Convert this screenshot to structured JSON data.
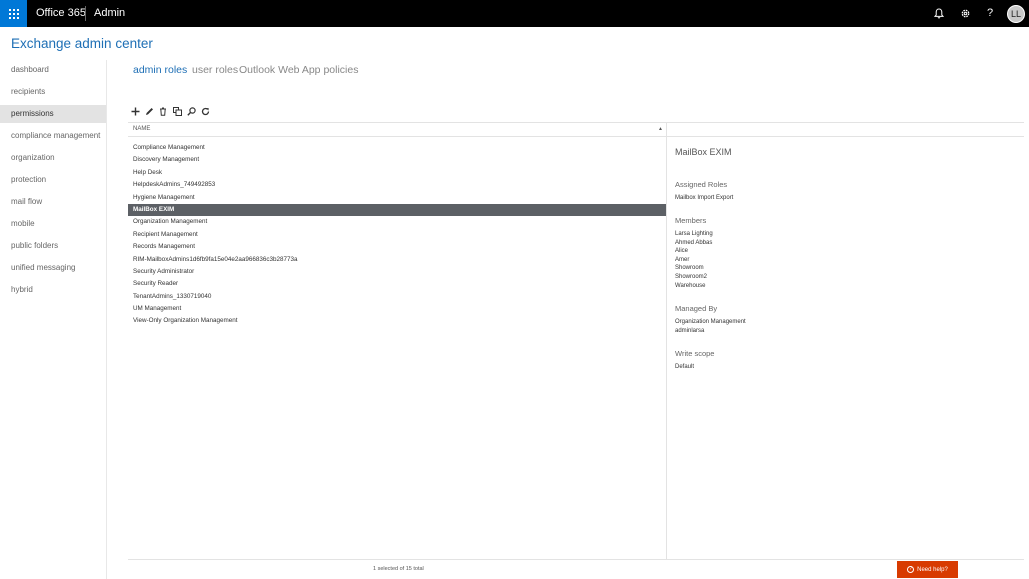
{
  "topbar": {
    "brand": "Office 365",
    "section": "Admin",
    "avatar_initials": "LL",
    "icons": [
      "app-launcher-icon",
      "bell-icon",
      "gear-icon",
      "help-icon"
    ]
  },
  "header": {
    "title": "Exchange admin center"
  },
  "nav": {
    "items": [
      {
        "label": "dashboard"
      },
      {
        "label": "recipients"
      },
      {
        "label": "permissions"
      },
      {
        "label": "compliance management"
      },
      {
        "label": "organization"
      },
      {
        "label": "protection"
      },
      {
        "label": "mail flow"
      },
      {
        "label": "mobile"
      },
      {
        "label": "public folders"
      },
      {
        "label": "unified messaging"
      },
      {
        "label": "hybrid"
      }
    ],
    "active": "permissions"
  },
  "tabs": [
    {
      "label": "admin roles"
    },
    {
      "label": "user roles"
    },
    {
      "label": "Outlook Web App policies"
    }
  ],
  "toolbar": {
    "icons": [
      "add-icon",
      "edit-icon",
      "delete-icon",
      "copy-icon",
      "search-icon",
      "refresh-icon"
    ]
  },
  "list": {
    "column_header": "NAME",
    "rows": [
      "Compliance Management",
      "Discovery Management",
      "Help Desk",
      "HelpdeskAdmins_749492853",
      "Hygiene Management",
      "MailBox EXIM",
      "Organization Management",
      "Recipient Management",
      "Records Management",
      "RIM-MailboxAdmins1d6fb9fa15e04e2aa966836c3b28773a",
      "Security Administrator",
      "Security Reader",
      "TenantAdmins_1330719040",
      "UM Management",
      "View-Only Organization Management"
    ],
    "selected_index": 5
  },
  "details": {
    "title": "MailBox EXIM",
    "assigned_roles_label": "Assigned Roles",
    "assigned_roles": [
      "Mailbox Import Export"
    ],
    "members_label": "Members",
    "members": [
      "Larsa Lighting",
      "Ahmed Abbas",
      "Alice",
      "Amer",
      "Showroom",
      "Showroom2",
      "Warehouse"
    ],
    "managed_by_label": "Managed By",
    "managed_by": [
      "Organization Management",
      "adminlarsa"
    ],
    "write_scope_label": "Write scope",
    "write_scope": "Default"
  },
  "footer": {
    "status": "1 selected of 15 total",
    "help_label": "Need help?"
  },
  "colors": {
    "accent": "#1e6fb5",
    "waffle": "#0078d7",
    "help": "#d83b01",
    "selected_row": "#5c6065"
  }
}
